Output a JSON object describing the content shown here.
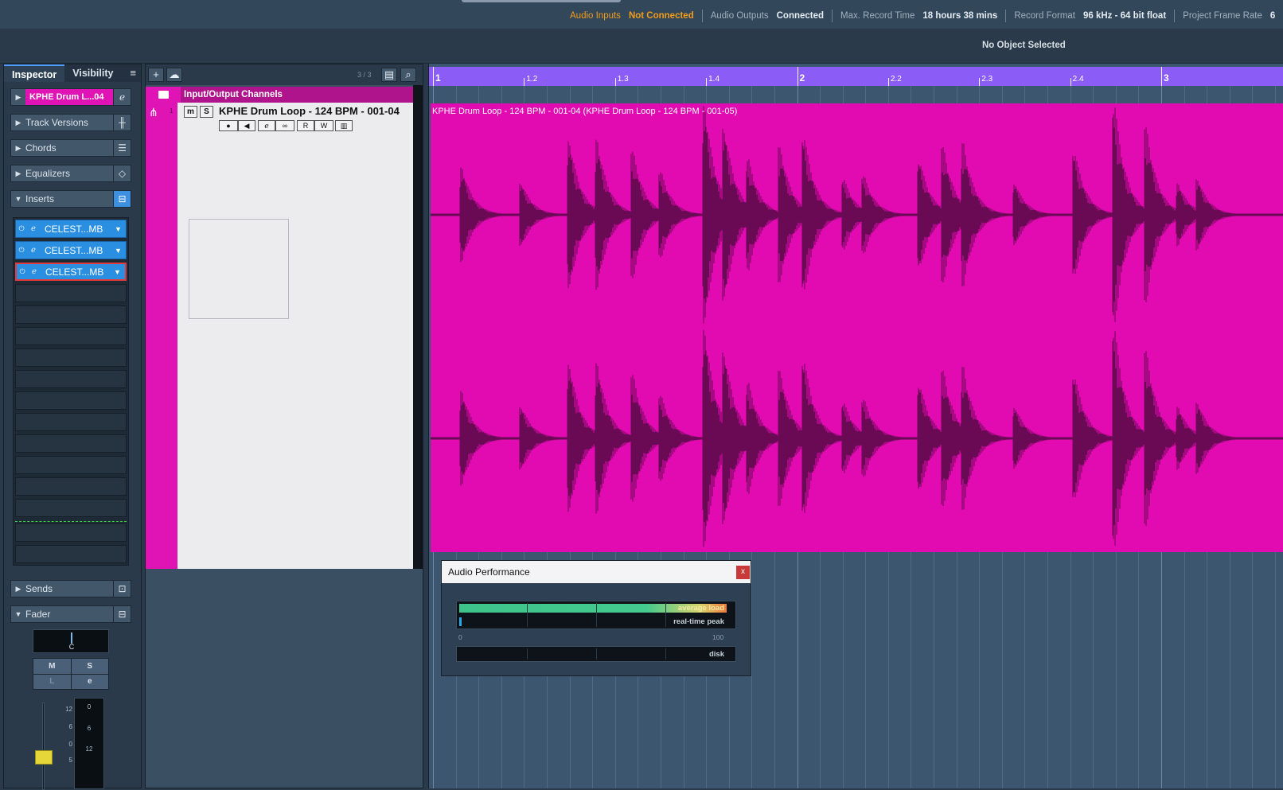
{
  "status_bar": {
    "items": [
      {
        "label": "Audio Inputs",
        "value": "Not Connected",
        "accent": "#f39c1a"
      },
      {
        "label": "Audio Outputs",
        "value": "Connected"
      },
      {
        "label": "Max. Record Time",
        "value": "18 hours 38 mins"
      },
      {
        "label": "Record Format",
        "value": "96 kHz - 64 bit float"
      },
      {
        "label": "Project Frame Rate",
        "value": "6"
      }
    ]
  },
  "info_line": {
    "text": "No Object Selected"
  },
  "inspector": {
    "tabs": [
      "Inspector",
      "Visibility"
    ],
    "menu_icon": "≡",
    "track_name": "KPHE Drum L...04",
    "sections": {
      "track_versions": "Track Versions",
      "chords": "Chords",
      "equalizers": "Equalizers",
      "inserts": "Inserts",
      "sends": "Sends",
      "fader": "Fader"
    },
    "inserts": [
      {
        "name": "CELEST...MB",
        "selected": false
      },
      {
        "name": "CELEST...MB",
        "selected": false
      },
      {
        "name": "CELEST...MB",
        "selected": true
      }
    ],
    "pan_value": "C",
    "buttons": {
      "mute": "M",
      "solo": "S",
      "listen": "L",
      "edit": "e"
    },
    "fader_scale": [
      "12",
      "6",
      "0",
      "5"
    ],
    "meter_scale": [
      "0",
      "6",
      "12"
    ]
  },
  "track_list": {
    "count": "3 / 3",
    "folder_name": "Input/Output Channels",
    "track": {
      "number": "1",
      "name": "KPHE Drum Loop - 124 BPM - 001-04",
      "mute": "m",
      "solo": "S"
    }
  },
  "ruler": {
    "labels": [
      "1",
      "1.2",
      "1.3",
      "1.4",
      "2",
      "2.2",
      "2.3",
      "2.4",
      "3"
    ]
  },
  "event": {
    "name": "KPHE Drum Loop - 124 BPM - 001-04 (KPHE Drum Loop - 124 BPM - 001-05)",
    "color": "#e10bb1"
  },
  "audio_performance": {
    "title": "Audio Performance",
    "close": "x",
    "average_load_label": "average load",
    "realtime_peak_label": "real-time peak",
    "disk_label": "disk",
    "scale_min": "0",
    "scale_max": "100",
    "average_load_percent": 100,
    "realtime_peak_percent": 1,
    "disk_percent": 0
  }
}
